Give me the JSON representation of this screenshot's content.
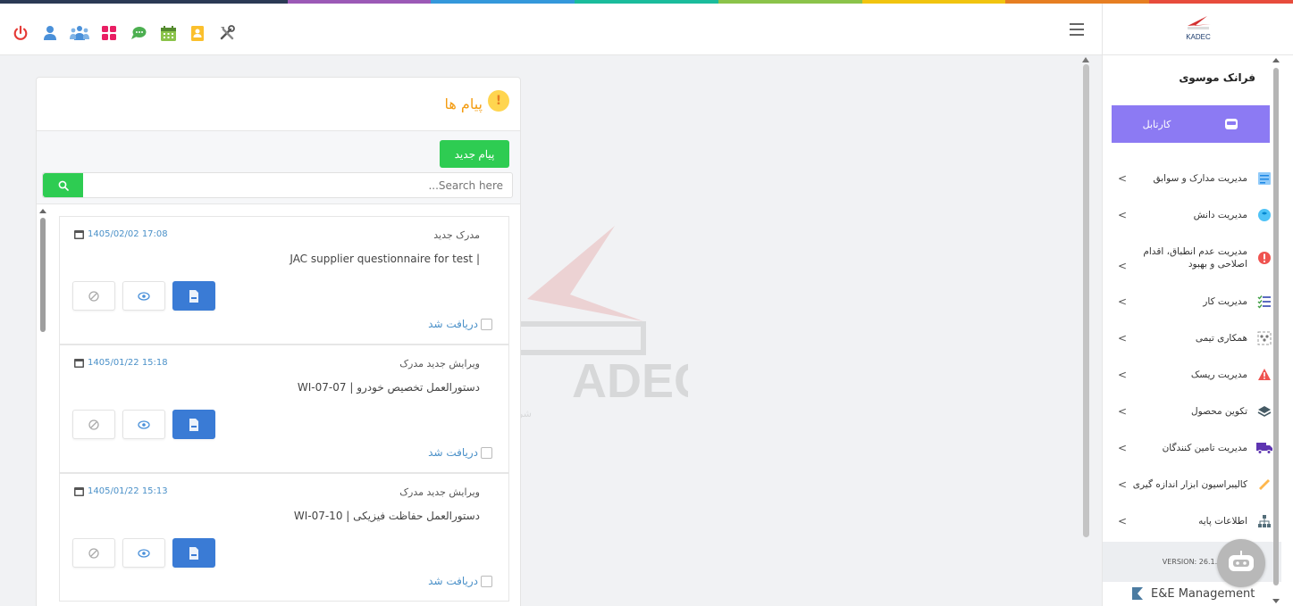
{
  "stripe_colors": [
    "#2b3a55",
    "#2b3a55",
    "#9b59b6",
    "#3498db",
    "#1abc9c",
    "#8bc34a",
    "#f1c40f",
    "#e67e22",
    "#e74c3c"
  ],
  "topbar": {
    "icons": [
      "power-icon",
      "user-icon",
      "users-icon",
      "apps-grid-icon",
      "chat-icon",
      "calendar-icon",
      "contacts-icon",
      "tools-icon"
    ]
  },
  "logo": {
    "text": "KADEC"
  },
  "messages": {
    "title": "پیام ها",
    "new_button": "پیام جدید",
    "search_placeholder": "...Search here",
    "items": [
      {
        "date": "1405/02/02 17:08",
        "type": "مدرک جدید",
        "subject": "| JAC supplier questionnaire for test",
        "received": "دریافت شد"
      },
      {
        "date": "1405/01/22 15:18",
        "type": "ویرایش جدید مدرک",
        "subject": "دستورالعمل تخصیص خودرو | WI-07-07",
        "received": "دریافت شد"
      },
      {
        "date": "1405/01/22 15:13",
        "type": "ویرایش جدید مدرک",
        "subject": "دستورالعمل حفاظت فیزیکی | WI-07-10",
        "received": "دریافت شد"
      }
    ]
  },
  "watermark": {
    "brand": "ADEC",
    "tagline": "شرکت طراحی و مهندسی قطعات"
  },
  "sidebar": {
    "user_name": "فرانک موسوی",
    "cartable": "کارتابل",
    "items": [
      {
        "label": "مدیریت مدارک و سوابق",
        "icon": "documents-icon"
      },
      {
        "label": "مدیریت دانش",
        "icon": "brain-icon"
      },
      {
        "label": "مدیریت عدم انطباق، اقدام اصلاحی و بهبود",
        "icon": "warning-circle-icon"
      },
      {
        "label": "مدیریت کار",
        "icon": "task-list-icon"
      },
      {
        "label": "همکاری تیمی",
        "icon": "team-icon"
      },
      {
        "label": "مدیریت ریسک",
        "icon": "risk-triangle-icon"
      },
      {
        "label": "تکوین محصول",
        "icon": "layers-icon"
      },
      {
        "label": "مدیریت تامین کنندگان",
        "icon": "truck-icon"
      },
      {
        "label": "کالیبراسیون ابزار اندازه گیری",
        "icon": "ruler-icon"
      },
      {
        "label": "اطلاعات پایه",
        "icon": "hierarchy-icon"
      }
    ],
    "version": "VERSION: 26.1.7",
    "brand": "E&E Management"
  }
}
